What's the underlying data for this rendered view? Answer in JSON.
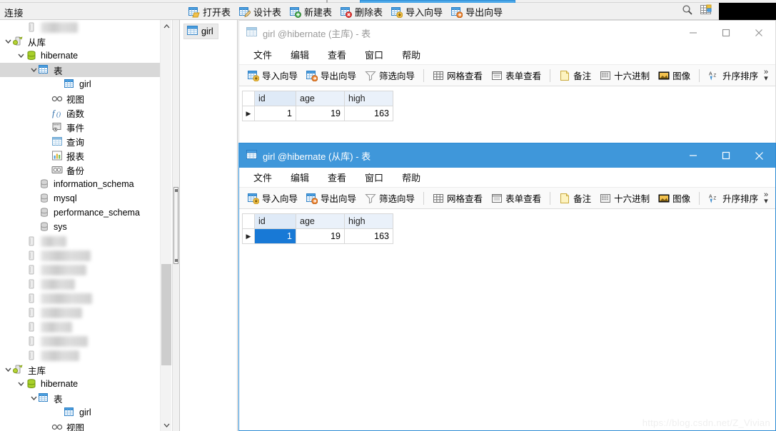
{
  "app": {
    "connections_label": "连接",
    "watermark": "https://blog.csdn.net/Z_Vivian"
  },
  "main_toolbar": {
    "buttons": [
      {
        "label": "打开表",
        "icon": "open-table-icon"
      },
      {
        "label": "设计表",
        "icon": "design-table-icon"
      },
      {
        "label": "新建表",
        "icon": "new-table-icon"
      },
      {
        "label": "删除表",
        "icon": "delete-table-icon"
      },
      {
        "label": "导入向导",
        "icon": "import-wizard-icon"
      },
      {
        "label": "导出向导",
        "icon": "export-wizard-icon"
      }
    ],
    "right_icons": [
      {
        "name": "search-icon"
      },
      {
        "name": "grid-view-icon"
      }
    ]
  },
  "sidebar": {
    "tree": [
      {
        "label": "",
        "indent": 1,
        "icon": "server-icon",
        "twist": "none",
        "blurred": true,
        "blur_width": 52
      },
      {
        "label": "从库",
        "indent": 0,
        "icon": "connection-icon",
        "twist": "down"
      },
      {
        "label": "hibernate",
        "indent": 1,
        "icon": "database-icon",
        "twist": "down"
      },
      {
        "label": "表",
        "indent": 2,
        "icon": "table-folder-icon",
        "twist": "down",
        "selected": true
      },
      {
        "label": "girl",
        "indent": 4,
        "icon": "table-icon",
        "twist": "none"
      },
      {
        "label": "视图",
        "indent": 3,
        "icon": "view-icon",
        "twist": "none"
      },
      {
        "label": "函数",
        "indent": 3,
        "icon": "function-icon",
        "twist": "none"
      },
      {
        "label": "事件",
        "indent": 3,
        "icon": "event-icon",
        "twist": "none"
      },
      {
        "label": "查询",
        "indent": 3,
        "icon": "query-icon",
        "twist": "none"
      },
      {
        "label": "报表",
        "indent": 3,
        "icon": "report-icon",
        "twist": "none"
      },
      {
        "label": "备份",
        "indent": 3,
        "icon": "backup-icon",
        "twist": "none"
      },
      {
        "label": "information_schema",
        "indent": 2,
        "icon": "database-gray-icon",
        "twist": "none"
      },
      {
        "label": "mysql",
        "indent": 2,
        "icon": "database-gray-icon",
        "twist": "none"
      },
      {
        "label": "performance_schema",
        "indent": 2,
        "icon": "database-gray-icon",
        "twist": "none"
      },
      {
        "label": "sys",
        "indent": 2,
        "icon": "database-gray-icon",
        "twist": "none"
      },
      {
        "label": "",
        "indent": 1,
        "icon": "server-icon",
        "twist": "none",
        "blurred": true,
        "blur_width": 36
      },
      {
        "label": "",
        "indent": 1,
        "icon": "server-icon",
        "twist": "none",
        "blurred": true,
        "blur_width": 70
      },
      {
        "label": "",
        "indent": 1,
        "icon": "server-icon",
        "twist": "none",
        "blurred": true,
        "blur_width": 64
      },
      {
        "label": "",
        "indent": 1,
        "icon": "server-icon",
        "twist": "none",
        "blurred": true,
        "blur_width": 48
      },
      {
        "label": "",
        "indent": 1,
        "icon": "server-icon",
        "twist": "none",
        "blurred": true,
        "blur_width": 72
      },
      {
        "label": "",
        "indent": 1,
        "icon": "server-icon",
        "twist": "none",
        "blurred": true,
        "blur_width": 58
      },
      {
        "label": "",
        "indent": 1,
        "icon": "server-icon",
        "twist": "none",
        "blurred": true,
        "blur_width": 44
      },
      {
        "label": "",
        "indent": 1,
        "icon": "server-icon",
        "twist": "none",
        "blurred": true,
        "blur_width": 66
      },
      {
        "label": "",
        "indent": 1,
        "icon": "server-icon",
        "twist": "none",
        "blurred": true,
        "blur_width": 54
      },
      {
        "label": "主库",
        "indent": 0,
        "icon": "connection-icon",
        "twist": "down"
      },
      {
        "label": "hibernate",
        "indent": 1,
        "icon": "database-icon",
        "twist": "down"
      },
      {
        "label": "表",
        "indent": 2,
        "icon": "table-folder-icon",
        "twist": "down"
      },
      {
        "label": "girl",
        "indent": 4,
        "icon": "table-icon",
        "twist": "none"
      },
      {
        "label": "视图",
        "indent": 3,
        "icon": "view-icon",
        "twist": "none"
      }
    ]
  },
  "tabstrip": {
    "tabs": [
      {
        "label": "girl",
        "icon": "table-icon",
        "active": true
      }
    ]
  },
  "windows": [
    {
      "id": "window-master",
      "title": "girl @hibernate (主库) - 表",
      "active": false,
      "menu": [
        "文件",
        "编辑",
        "查看",
        "窗口",
        "帮助"
      ],
      "toolbar": [
        {
          "label": "导入向导",
          "icon": "import-wizard-icon"
        },
        {
          "label": "导出向导",
          "icon": "export-wizard-icon"
        },
        {
          "label": "筛选向导",
          "icon": "filter-wizard-icon"
        },
        {
          "sep": true
        },
        {
          "label": "网格查看",
          "icon": "grid-view-icon"
        },
        {
          "label": "表单查看",
          "icon": "form-view-icon"
        },
        {
          "sep": true
        },
        {
          "label": "备注",
          "icon": "memo-icon"
        },
        {
          "label": "十六进制",
          "icon": "hex-icon"
        },
        {
          "label": "图像",
          "icon": "image-icon"
        },
        {
          "sep": true
        },
        {
          "label": "升序排序",
          "icon": "sort-asc-icon"
        }
      ],
      "overflow_label": "»",
      "grid": {
        "columns": [
          "id",
          "age",
          "high"
        ],
        "rows": [
          {
            "cells": [
              "1",
              "19",
              "163"
            ],
            "current": true,
            "selected_col": -1
          }
        ]
      },
      "caption": {
        "minimize": "—",
        "maximize": "▢",
        "close": "✕"
      }
    },
    {
      "id": "window-slave",
      "title": "girl @hibernate (从库) - 表",
      "active": true,
      "menu": [
        "文件",
        "编辑",
        "查看",
        "窗口",
        "帮助"
      ],
      "toolbar": [
        {
          "label": "导入向导",
          "icon": "import-wizard-icon"
        },
        {
          "label": "导出向导",
          "icon": "export-wizard-icon"
        },
        {
          "label": "筛选向导",
          "icon": "filter-wizard-icon"
        },
        {
          "sep": true
        },
        {
          "label": "网格查看",
          "icon": "grid-view-icon"
        },
        {
          "label": "表单查看",
          "icon": "form-view-icon"
        },
        {
          "sep": true
        },
        {
          "label": "备注",
          "icon": "memo-icon"
        },
        {
          "label": "十六进制",
          "icon": "hex-icon"
        },
        {
          "label": "图像",
          "icon": "image-icon"
        },
        {
          "sep": true
        },
        {
          "label": "升序排序",
          "icon": "sort-asc-icon"
        }
      ],
      "overflow_label": "»",
      "grid": {
        "columns": [
          "id",
          "age",
          "high"
        ],
        "rows": [
          {
            "cells": [
              "1",
              "19",
              "163"
            ],
            "current": true,
            "selected_col": 0
          }
        ]
      },
      "caption": {
        "minimize": "—",
        "maximize": "▢",
        "close": "✕"
      }
    }
  ],
  "colors": {
    "active_title": "#3f97da",
    "selection": "#1879d6",
    "tree_selected": "#d8d8d8",
    "header": "#eaf1fa"
  }
}
